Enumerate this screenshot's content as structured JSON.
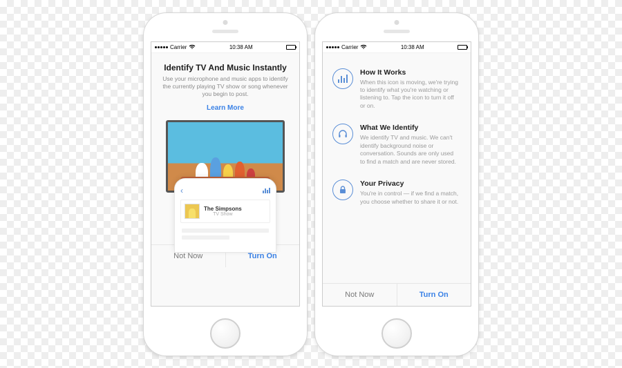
{
  "status_bar": {
    "carrier": "Carrier",
    "time": "10:38 AM"
  },
  "screen1": {
    "title": "Identify TV And Music Instantly",
    "description": "Use your microphone and music apps to identify the currently playing TV show or song whenever you begin to post.",
    "learn_more": "Learn More",
    "card": {
      "title": "The Simpsons",
      "subtitle": "TV Show"
    }
  },
  "screen2": {
    "items": [
      {
        "title": "How It Works",
        "body": "When this icon is moving, we're trying to identify what you're watching or listening to. Tap the icon to turn it off or on."
      },
      {
        "title": "What We Identify",
        "body": "We identify TV and music. We can't identify background noise or conversation. Sounds are only used to find a match and are never stored."
      },
      {
        "title": "Your Privacy",
        "body": "You're in control — if we find a match, you choose whether to share it or not."
      }
    ]
  },
  "buttons": {
    "not_now": "Not Now",
    "turn_on": "Turn On"
  }
}
